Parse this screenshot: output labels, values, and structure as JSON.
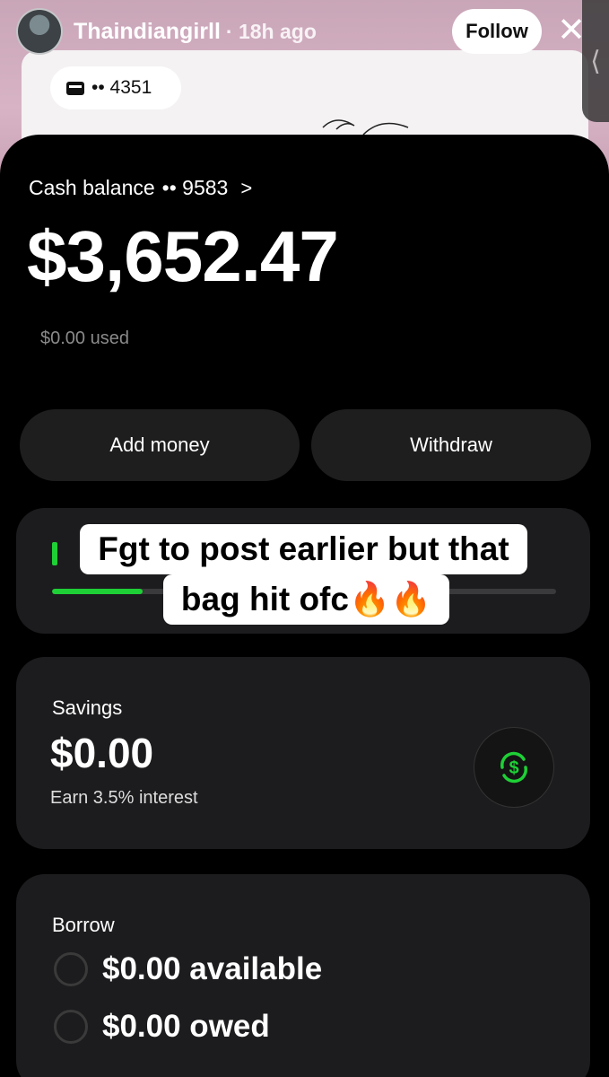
{
  "story": {
    "username": "Thaindiangirll",
    "time": "· 18h ago",
    "follow_label": "Follow",
    "close_glyph": "✕",
    "side_tab_glyph": "⟨",
    "card_chip": "•• 4351"
  },
  "wallet": {
    "cash_label": "Cash balance",
    "cash_account": "•• 9583",
    "cash_chevron": ">",
    "balance": "$3,652.47",
    "used": "$0.00 used",
    "add_money_label": "Add money",
    "withdraw_label": "Withdraw",
    "progress_fraction": 0.18,
    "accent_color": "#1ed036"
  },
  "caption": {
    "line1": "Fgt to post earlier but that",
    "line2": "bag hit ofc🔥🔥"
  },
  "savings": {
    "title": "Savings",
    "amount": "$0.00",
    "subtitle": "Earn 3.5% interest",
    "icon": "dollar-circle-icon"
  },
  "borrow": {
    "title": "Borrow",
    "available": "$0.00 available",
    "owed": "$0.00 owed"
  }
}
